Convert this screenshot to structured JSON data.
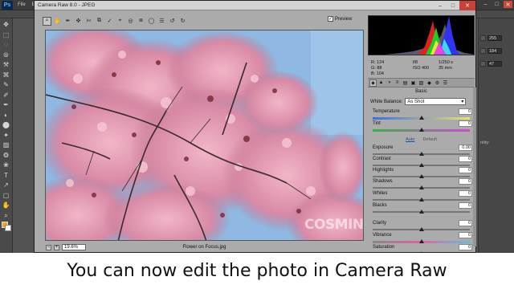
{
  "photoshop": {
    "logo": "Ps",
    "menu": [
      "File",
      "E"
    ],
    "window_controls": [
      "–",
      "□",
      "✕"
    ],
    "tools": [
      "✥",
      "⬚",
      "◌",
      "⦾",
      "⚒",
      "⌘",
      "✎",
      "✐",
      "✒",
      "◐",
      "⬤",
      "✦",
      "▨",
      "❂",
      "❀",
      "T",
      "↗",
      "▢",
      "✋",
      "⌕",
      "…"
    ],
    "foreground_color": "#f0a820",
    "background_color": "#ffffff",
    "dock_values": [
      "255",
      "184",
      "47"
    ],
    "dock_labels": [
      "",
      "",
      "ntity:"
    ]
  },
  "camera_raw": {
    "title": "Camera Raw 8.0  -  JPEG",
    "title_controls": [
      "–",
      "□",
      "✕"
    ],
    "tools": [
      "⌕",
      "✋",
      "✒",
      "✜",
      "✄",
      "⧉",
      "✓",
      "⌖",
      "◎",
      "⧈",
      "◯",
      "☰",
      "↺",
      "↻"
    ],
    "preview_label": "Preview",
    "preview_checked": "✓",
    "zoom_minus": "−",
    "zoom_plus": "+",
    "zoom_value": "19.6%",
    "filename": "Flower on Focus.jpg",
    "watermark": "COSMIN",
    "readout": {
      "r": "R:   124",
      "g": "G:    88",
      "b": "B:   104",
      "aperture": "f/8",
      "shutter": "1/250 s",
      "iso": "ISO 400",
      "focal": "35 mm"
    },
    "panel_tabs": [
      "◉",
      "▲",
      "◑",
      "≡",
      "▤",
      "▣",
      "▨",
      "◆",
      "⚙",
      "☰"
    ],
    "panel_heading": "Basic",
    "white_balance": {
      "label": "White Balance:",
      "value": "As Shot"
    },
    "auto_label": "Auto",
    "default_label": "Default",
    "sliders": [
      {
        "label": "Temperature",
        "value": "0",
        "pos": 0.5
      },
      {
        "label": "Tint",
        "value": "0",
        "pos": 0.5
      },
      {
        "label": "Exposure",
        "value": "0.00",
        "pos": 0.5
      },
      {
        "label": "Contrast",
        "value": "0",
        "pos": 0.5
      },
      {
        "label": "Highlights",
        "value": "0",
        "pos": 0.5
      },
      {
        "label": "Shadows",
        "value": "0",
        "pos": 0.5
      },
      {
        "label": "Whites",
        "value": "0",
        "pos": 0.5
      },
      {
        "label": "Blacks",
        "value": "0",
        "pos": 0.5
      },
      {
        "label": "Clarity",
        "value": "0",
        "pos": 0.5
      },
      {
        "label": "Vibrance",
        "value": "0",
        "pos": 0.5
      },
      {
        "label": "Saturation",
        "value": "0",
        "pos": 0.5
      }
    ]
  },
  "caption": "You can now edit the photo in Camera Raw"
}
